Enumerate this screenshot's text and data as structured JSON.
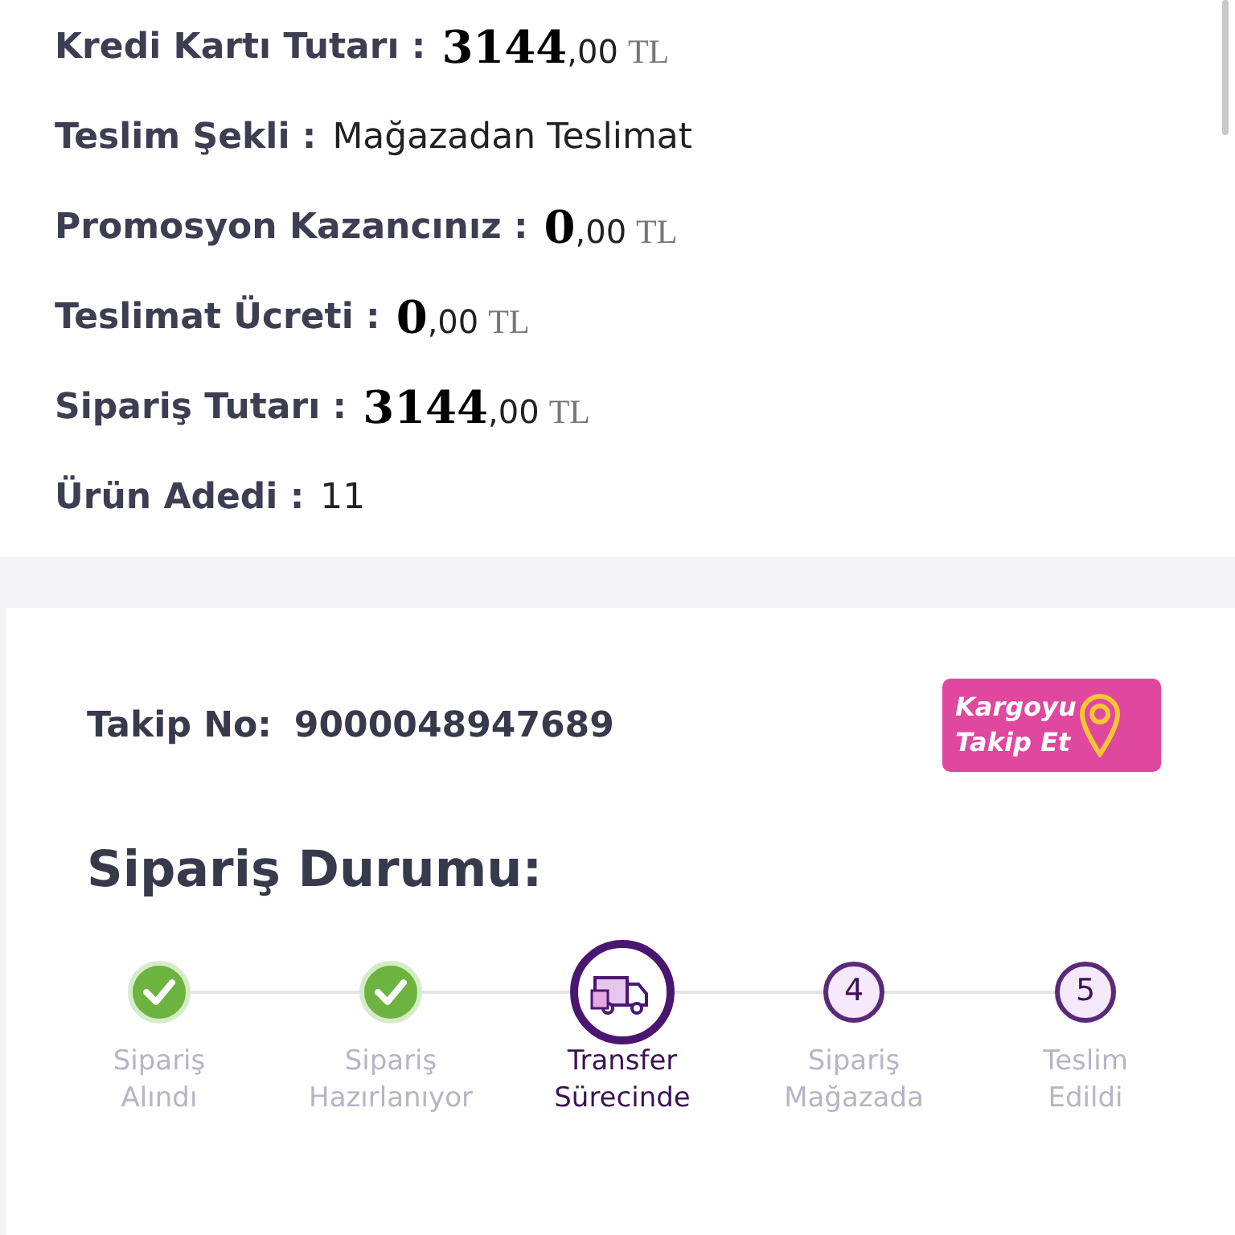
{
  "summary": [
    {
      "label": "Kredi Kartı Tutarı :",
      "kind": "amount",
      "integer": "3144",
      "decimals": ",00",
      "currency": "TL"
    },
    {
      "label": "Teslim Şekli :",
      "kind": "text",
      "value": "Mağazadan Teslimat"
    },
    {
      "label": "Promosyon Kazancınız :",
      "kind": "amount",
      "integer": "0",
      "decimals": ",00",
      "currency": "TL"
    },
    {
      "label": "Teslimat Ücreti :",
      "kind": "amount",
      "integer": "0",
      "decimals": ",00",
      "currency": "TL"
    },
    {
      "label": "Sipariş Tutarı :",
      "kind": "amount",
      "integer": "3144",
      "decimals": ",00",
      "currency": "TL"
    },
    {
      "label": "Ürün Adedi :",
      "kind": "text",
      "value": "11"
    }
  ],
  "tracking": {
    "label": "Takip No:",
    "number": "9000048947689",
    "button": [
      "Kargoyu",
      "Takip Et"
    ]
  },
  "status_title": "Sipariş Durumu:",
  "steps": [
    {
      "kind": "done",
      "label": [
        "Sipariş",
        "Alındı"
      ]
    },
    {
      "kind": "done",
      "label": [
        "Sipariş",
        "Hazırlanıyor"
      ]
    },
    {
      "kind": "current",
      "label": [
        "Transfer",
        "Sürecinde"
      ]
    },
    {
      "kind": "pending",
      "number": "4",
      "label": [
        "Sipariş",
        "Mağazada"
      ]
    },
    {
      "kind": "pending",
      "number": "5",
      "label": [
        "Teslim",
        "Edildi"
      ]
    }
  ]
}
